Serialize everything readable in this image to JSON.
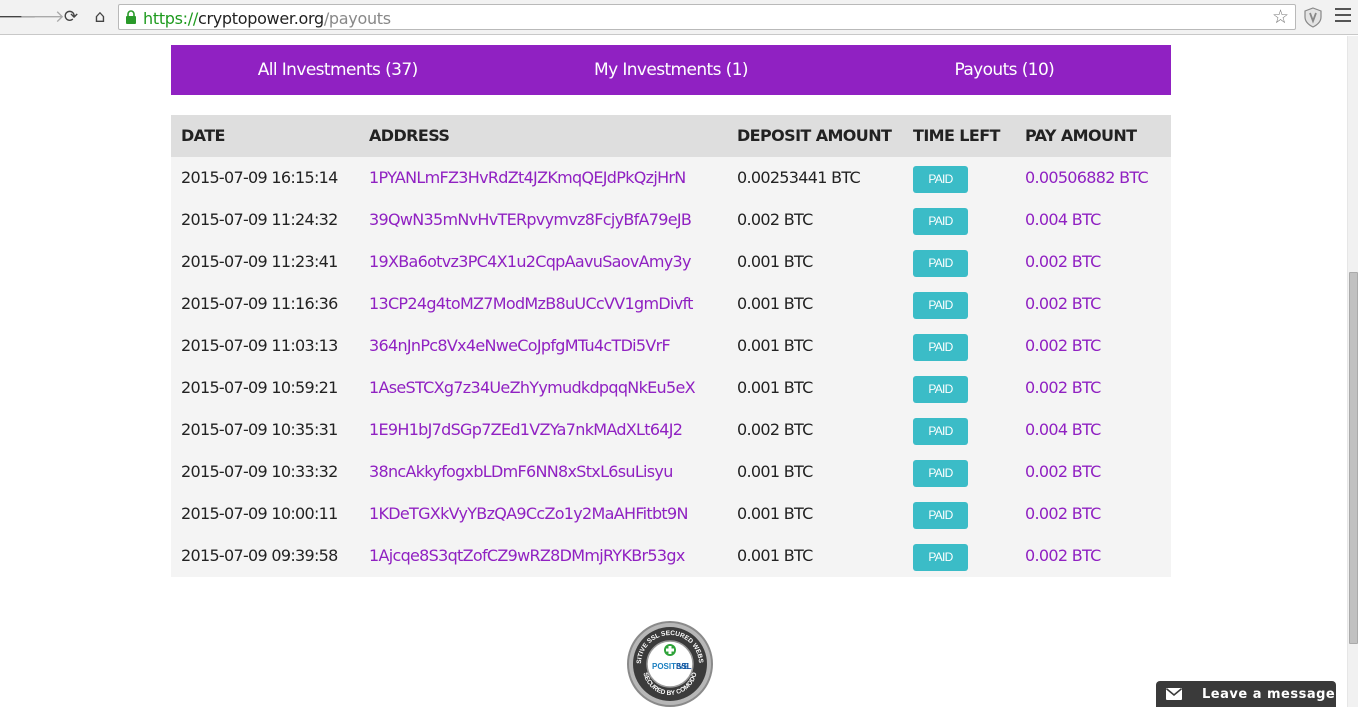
{
  "browser": {
    "url_scheme": "https://",
    "url_host": "cryptopower.org",
    "url_path": "/payouts",
    "back_glyph": "🡐",
    "forward_glyph": "🡒",
    "reload_glyph": "⟳",
    "home_glyph": "⌂",
    "star_glyph": "☆",
    "icons": {
      "lock": "lock-icon",
      "extension": "shield-icon",
      "menu": "hamburger-menu-icon"
    }
  },
  "tabs": [
    {
      "label": "All Investments (37)"
    },
    {
      "label": "My Investments (1)"
    },
    {
      "label": "Payouts (10)"
    }
  ],
  "table": {
    "headers": {
      "date": "DATE",
      "address": "ADDRESS",
      "deposit": "DEPOSIT AMOUNT",
      "time_left": "TIME LEFT",
      "pay": "PAY AMOUNT"
    },
    "rows": [
      {
        "date": "2015-07-09 16:15:14",
        "address": "1PYANLmFZ3HvRdZt4JZKmqQEJdPkQzjHrN",
        "deposit": "0.00253441 BTC",
        "status": "PAID",
        "pay": "0.00506882 BTC"
      },
      {
        "date": "2015-07-09 11:24:32",
        "address": "39QwN35mNvHvTERpvymvz8FcjyBfA79eJB",
        "deposit": "0.002 BTC",
        "status": "PAID",
        "pay": "0.004 BTC"
      },
      {
        "date": "2015-07-09 11:23:41",
        "address": "19XBa6otvz3PC4X1u2CqpAavuSaovAmy3y",
        "deposit": "0.001 BTC",
        "status": "PAID",
        "pay": "0.002 BTC"
      },
      {
        "date": "2015-07-09 11:16:36",
        "address": "13CP24g4toMZ7ModMzB8uUCcVV1gmDivft",
        "deposit": "0.001 BTC",
        "status": "PAID",
        "pay": "0.002 BTC"
      },
      {
        "date": "2015-07-09 11:03:13",
        "address": "364nJnPc8Vx4eNweCoJpfgMTu4cTDi5VrF",
        "deposit": "0.001 BTC",
        "status": "PAID",
        "pay": "0.002 BTC"
      },
      {
        "date": "2015-07-09 10:59:21",
        "address": "1AseSTCXg7z34UeZhYymudkdpqqNkEu5eX",
        "deposit": "0.001 BTC",
        "status": "PAID",
        "pay": "0.002 BTC"
      },
      {
        "date": "2015-07-09 10:35:31",
        "address": "1E9H1bJ7dSGp7ZEd1VZYa7nkMAdXLt64J2",
        "deposit": "0.002 BTC",
        "status": "PAID",
        "pay": "0.004 BTC"
      },
      {
        "date": "2015-07-09 10:33:32",
        "address": "38ncAkkyfogxbLDmF6NN8xStxL6suLisyu",
        "deposit": "0.001 BTC",
        "status": "PAID",
        "pay": "0.002 BTC"
      },
      {
        "date": "2015-07-09 10:00:11",
        "address": "1KDeTGXkVyYBzQA9CcZo1y2MaAHFitbt9N",
        "deposit": "0.001 BTC",
        "status": "PAID",
        "pay": "0.002 BTC"
      },
      {
        "date": "2015-07-09 09:39:58",
        "address": "1Ajcqe8S3qtZofCZ9wRZ8DMmjRYKBr53gx",
        "deposit": "0.001 BTC",
        "status": "PAID",
        "pay": "0.002 BTC"
      }
    ]
  },
  "ssl_seal": {
    "top_text": "POSITIVE SSL SECURED WEBSITE",
    "center_text_1": "POSITIVE",
    "center_text_2": "SSL",
    "bottom_text": "SECURED BY COMODO"
  },
  "chat": {
    "label": "Leave a message",
    "icon": "envelope-icon"
  },
  "colors": {
    "accent": "#9021c2",
    "paid_badge": "#3bbcc7",
    "header_bg": "#dedede",
    "row_bg": "#f4f4f4"
  }
}
